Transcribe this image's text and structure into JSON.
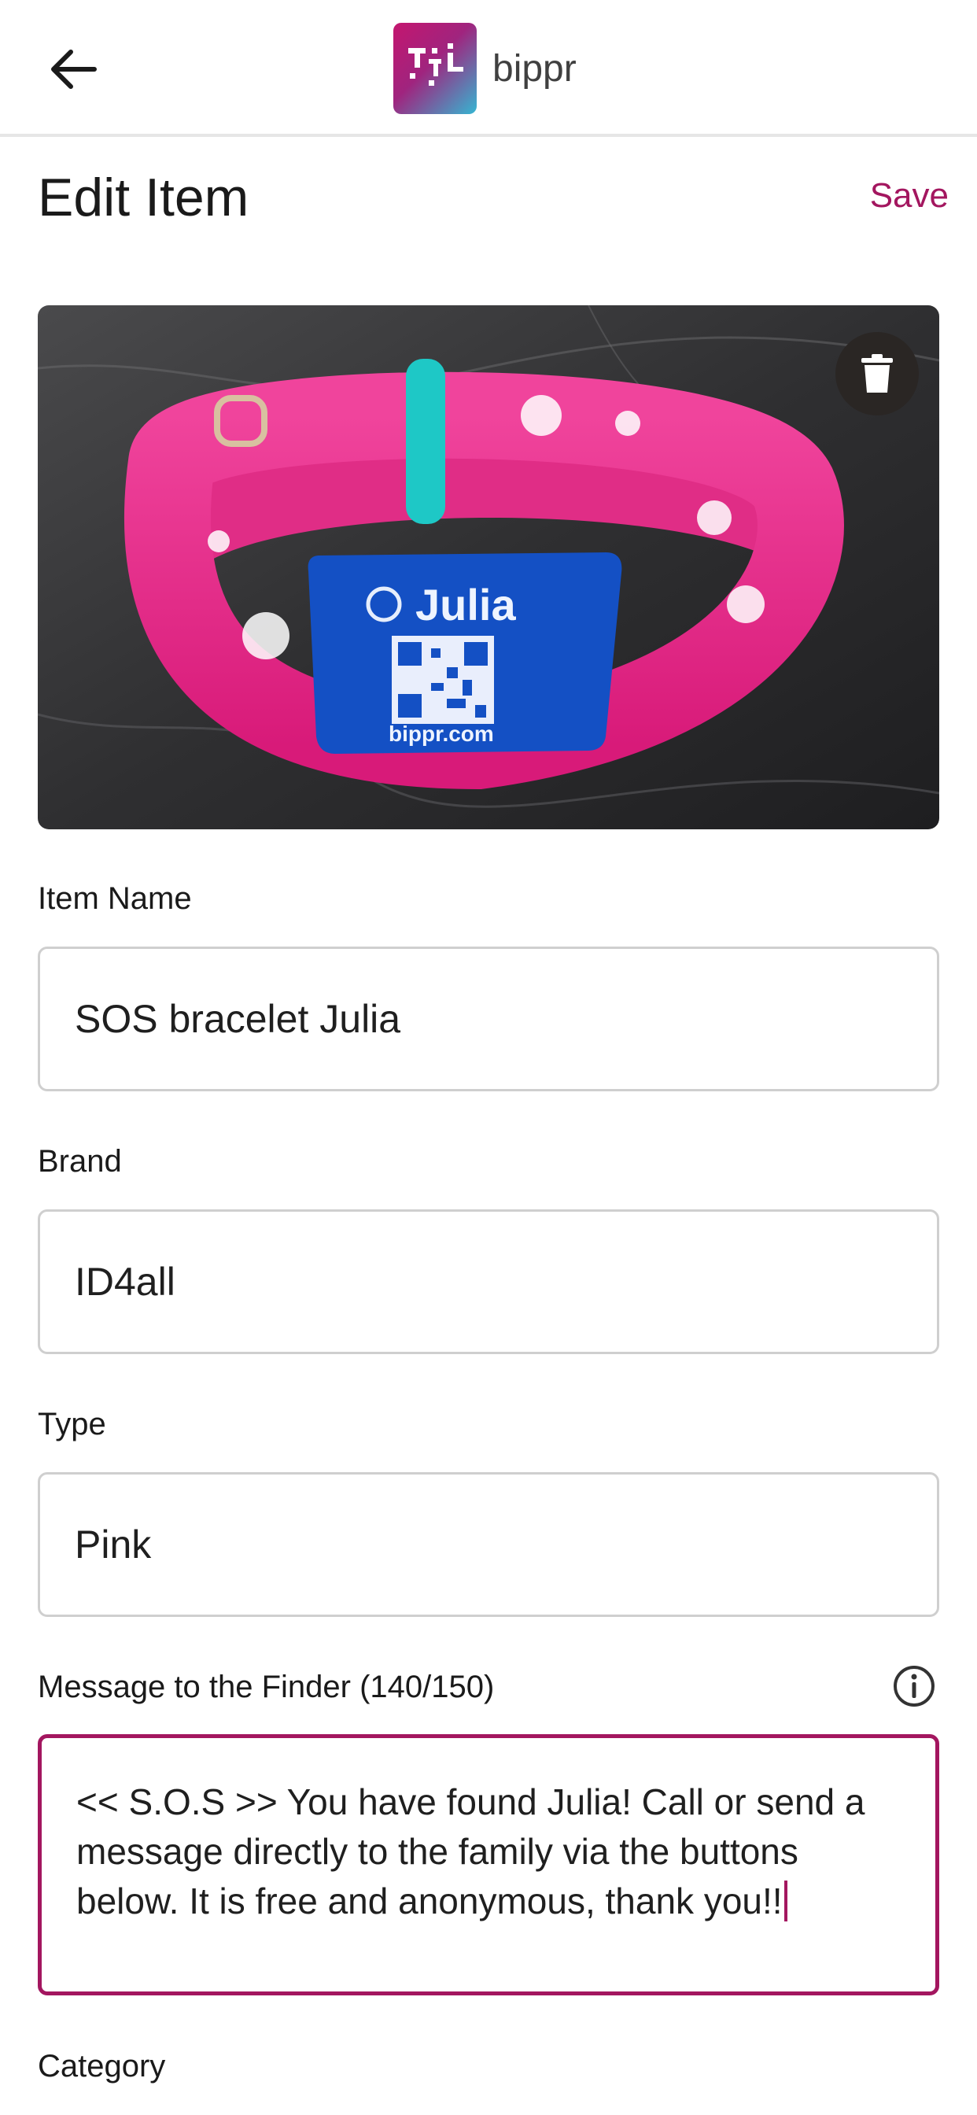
{
  "header": {
    "back_icon": "arrow-left-icon",
    "brand_name": "bippr"
  },
  "page": {
    "title": "Edit Item",
    "save_label": "Save"
  },
  "photo": {
    "tag_name": "Julia",
    "tag_url": "bippr.com",
    "delete_icon": "trash-icon"
  },
  "form": {
    "item_name": {
      "label": "Item Name",
      "value": "SOS bracelet Julia"
    },
    "brand": {
      "label": "Brand",
      "value": "ID4all"
    },
    "type": {
      "label": "Type",
      "value": "Pink"
    },
    "message": {
      "label": "Message to the Finder (140/150)",
      "value": "<< S.O.S >> You have found Julia! Call or send a message directly to the family via the buttons below. It is free and anonymous, thank you!!",
      "info_icon": "info-icon"
    },
    "category": {
      "label": "Category"
    }
  },
  "colors": {
    "accent": "#a3165f",
    "border": "#cfcfcf"
  }
}
